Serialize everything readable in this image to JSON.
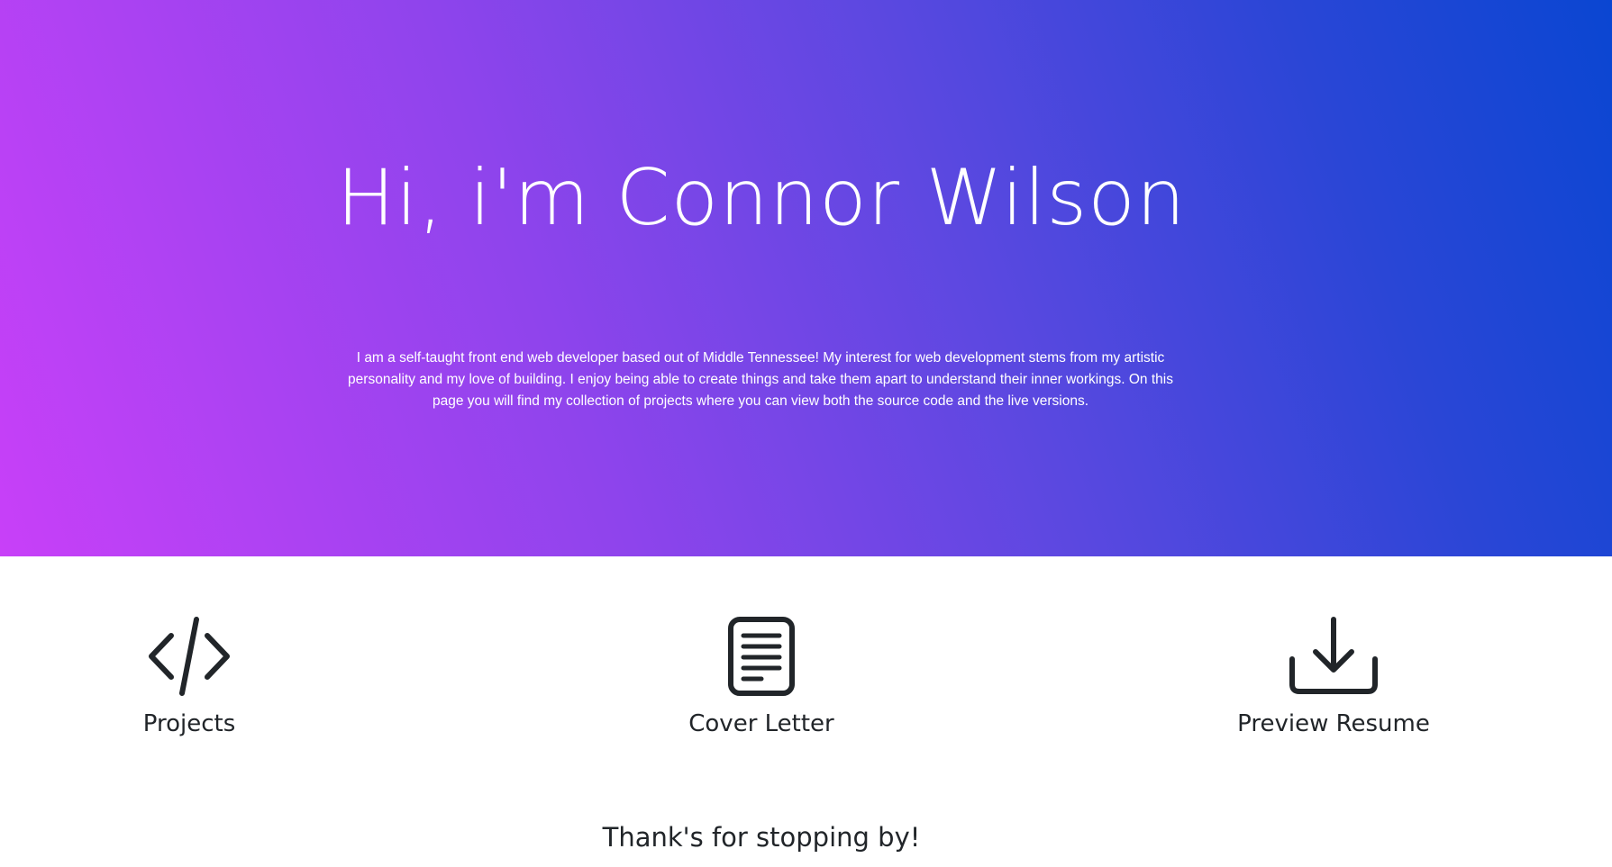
{
  "hero": {
    "title": "Hi, i'm Connor Wilson",
    "bio": "I am a self-taught front end web developer based out of Middle Tennessee! My interest for web development stems from my artistic personality and my love of building. I enjoy being able to create things and take them apart to understand their inner workings. On this page you will find my collection of projects where you can view both the source code and the live versions.",
    "gradient_colors": [
      "#c840f8",
      "#8e44ec",
      "#5a48e0",
      "#2a46d6",
      "#0a46d2"
    ]
  },
  "links": [
    {
      "label": "Projects",
      "icon": "code-icon"
    },
    {
      "label": "Cover Letter",
      "icon": "document-icon"
    },
    {
      "label": "Preview Resume",
      "icon": "download-icon"
    }
  ],
  "footer": {
    "text": "Thank's for stopping by!"
  }
}
